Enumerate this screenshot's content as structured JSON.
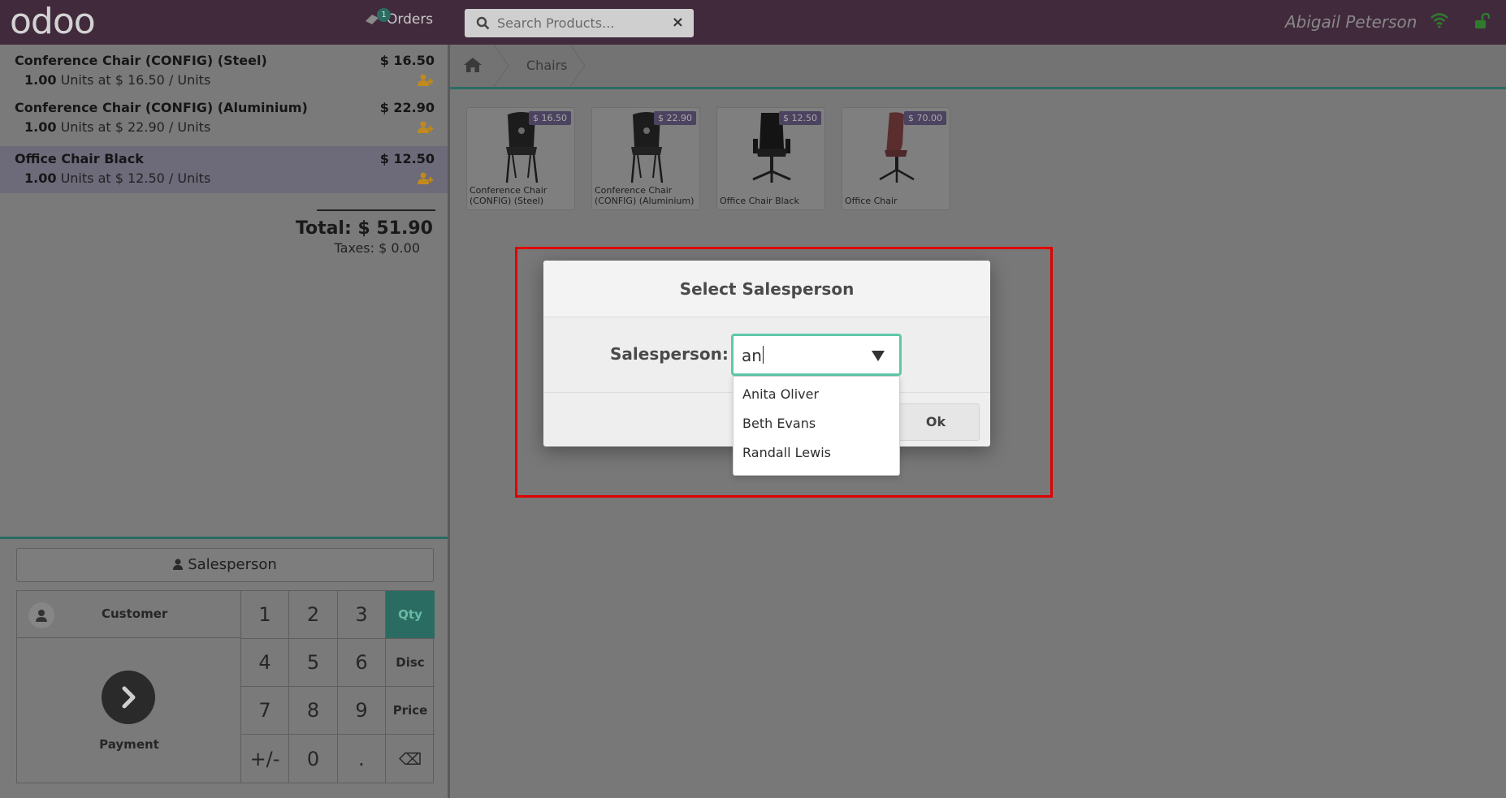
{
  "topbar": {
    "logo": "odoo",
    "orders_label": "Orders",
    "orders_count": "1",
    "search_placeholder": "Search Products...",
    "clear_icon": "×",
    "user_name": "Abigail Peterson"
  },
  "order_lines": [
    {
      "name": "Conference Chair (CONFIG) (Steel)",
      "price": "$ 16.50",
      "qty": "1.00",
      "info": "Units at $ 16.50 / Units"
    },
    {
      "name": "Conference Chair (CONFIG) (Aluminium)",
      "price": "$ 22.90",
      "qty": "1.00",
      "info": "Units at $ 22.90 / Units"
    },
    {
      "name": "Office Chair Black",
      "price": "$ 12.50",
      "qty": "1.00",
      "info": "Units at $ 12.50 / Units"
    }
  ],
  "totals": {
    "total": "Total: $ 51.90",
    "taxes": "Taxes: $ 0.00"
  },
  "control": {
    "salesperson_button": "Salesperson",
    "customer_label": "Customer",
    "payment_label": "Payment",
    "keys": [
      "1",
      "2",
      "3",
      "Qty",
      "4",
      "5",
      "6",
      "Disc",
      "7",
      "8",
      "9",
      "Price",
      "+/-",
      "0",
      ".",
      "⌫"
    ],
    "active_mode": "Qty"
  },
  "breadcrumb": {
    "category": "Chairs"
  },
  "products": [
    {
      "name": "Conference Chair (CONFIG) (Steel)",
      "price": "$ 16.50"
    },
    {
      "name": "Conference Chair (CONFIG) (Aluminium)",
      "price": "$ 22.90"
    },
    {
      "name": "Office Chair Black",
      "price": "$ 12.50"
    },
    {
      "name": "Office Chair",
      "price": "$ 70.00"
    }
  ],
  "modal": {
    "title": "Select Salesperson",
    "field_label": "Salesperson:",
    "input_value": "an",
    "options": [
      "Anita Oliver",
      "Beth Evans",
      "Randall Lewis"
    ],
    "ok_label": "Ok"
  },
  "colors": {
    "topbar": "#422a3d",
    "accent": "#2a6c61",
    "input_focus": "#5ec8a8",
    "highlight": "#e00000",
    "salesperson_icon": "#c08a1e"
  }
}
